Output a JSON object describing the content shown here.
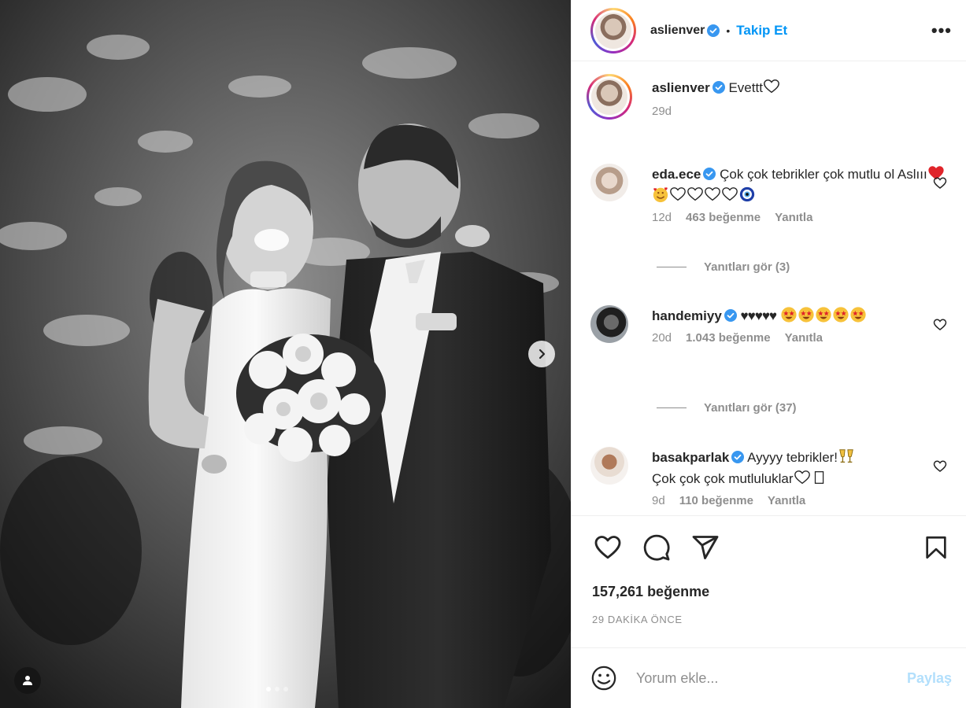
{
  "post": {
    "author": "aslienver",
    "follow_label": "Takip Et",
    "separator": "•",
    "more_label": "•••",
    "caption_text": "Evettt",
    "caption_time": "29d"
  },
  "comments": [
    {
      "username": "eda.ece",
      "text": "Çok çok tebrikler çok mutlu ol Aslııı",
      "time": "12d",
      "likes": "463 beğenme",
      "reply_label": "Yanıtla",
      "view_replies": "Yanıtları gör (3)"
    },
    {
      "username": "handemiyy",
      "text": "♥♥♥♥♥",
      "time": "20d",
      "likes": "1.043 beğenme",
      "reply_label": "Yanıtla",
      "view_replies": "Yanıtları gör (37)"
    },
    {
      "username": "basakparlak",
      "text_line1": "Ayyyy tebrikler!",
      "text_line2": "Çok çok çok mutluluklar",
      "time": "9d",
      "likes": "110 beğenme",
      "reply_label": "Yanıtla"
    }
  ],
  "footer": {
    "likes": "157,261 beğenme",
    "time": "29 DAKİKA ÖNCE",
    "comment_placeholder": "Yorum ekle...",
    "post_label": "Paylaş"
  },
  "carousel": {
    "slide_count": 3,
    "active_index": 0
  },
  "colors": {
    "link_blue": "#0095f6",
    "verified_blue": "#3897f0",
    "muted": "#8e8e8e",
    "text": "#262626",
    "post_disabled": "#b2dffc"
  }
}
